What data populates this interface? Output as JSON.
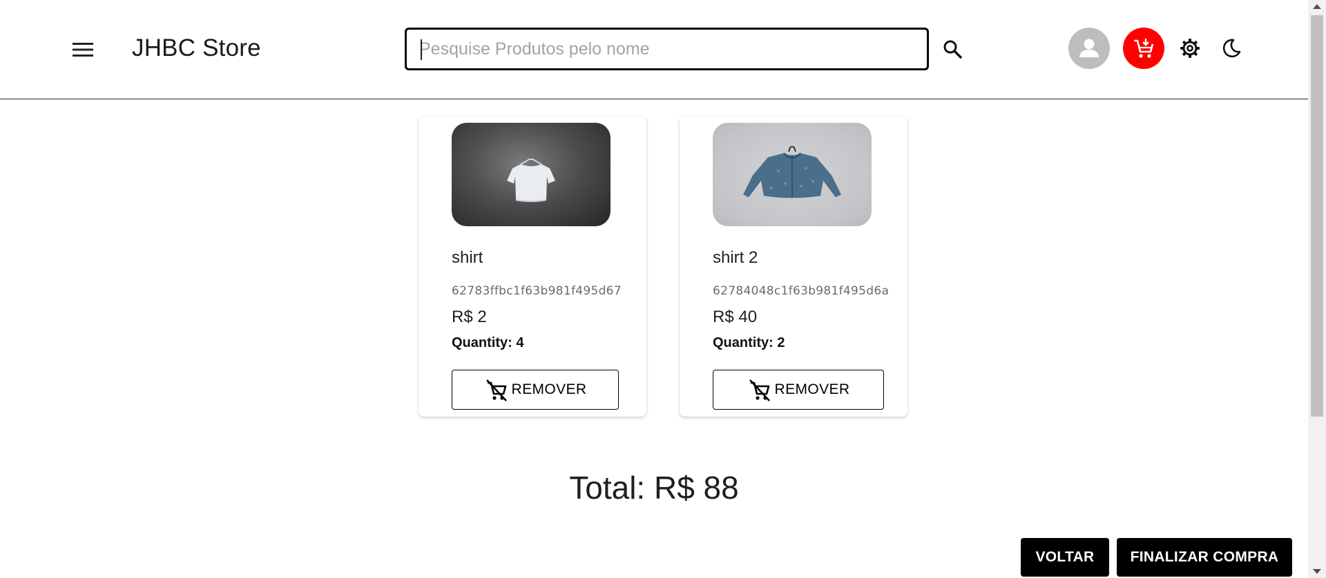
{
  "header": {
    "brand": "JHBC Store",
    "search_placeholder": "Pesquise Produtos pelo nome",
    "search_value": "",
    "cart_color": "#ff0000",
    "avatar_color": "#bdbdbd"
  },
  "cart": {
    "items": [
      {
        "name": "shirt",
        "id": "62783ffbc1f63b981f495d67",
        "price": "R$ 2",
        "quantity": "Quantity: 4",
        "remove_label": "REMOVER",
        "image": "white-shirt-on-dark-background"
      },
      {
        "name": "shirt 2",
        "id": "62784048c1f63b981f495d6a",
        "price": "R$ 40",
        "quantity": "Quantity: 2",
        "remove_label": "REMOVER",
        "image": "blue-denim-shirt-on-grey-background"
      }
    ],
    "total": "Total: R$ 88"
  },
  "footer": {
    "back_label": "VOLTAR",
    "finish_label": "FINALIZAR COMPRA"
  }
}
